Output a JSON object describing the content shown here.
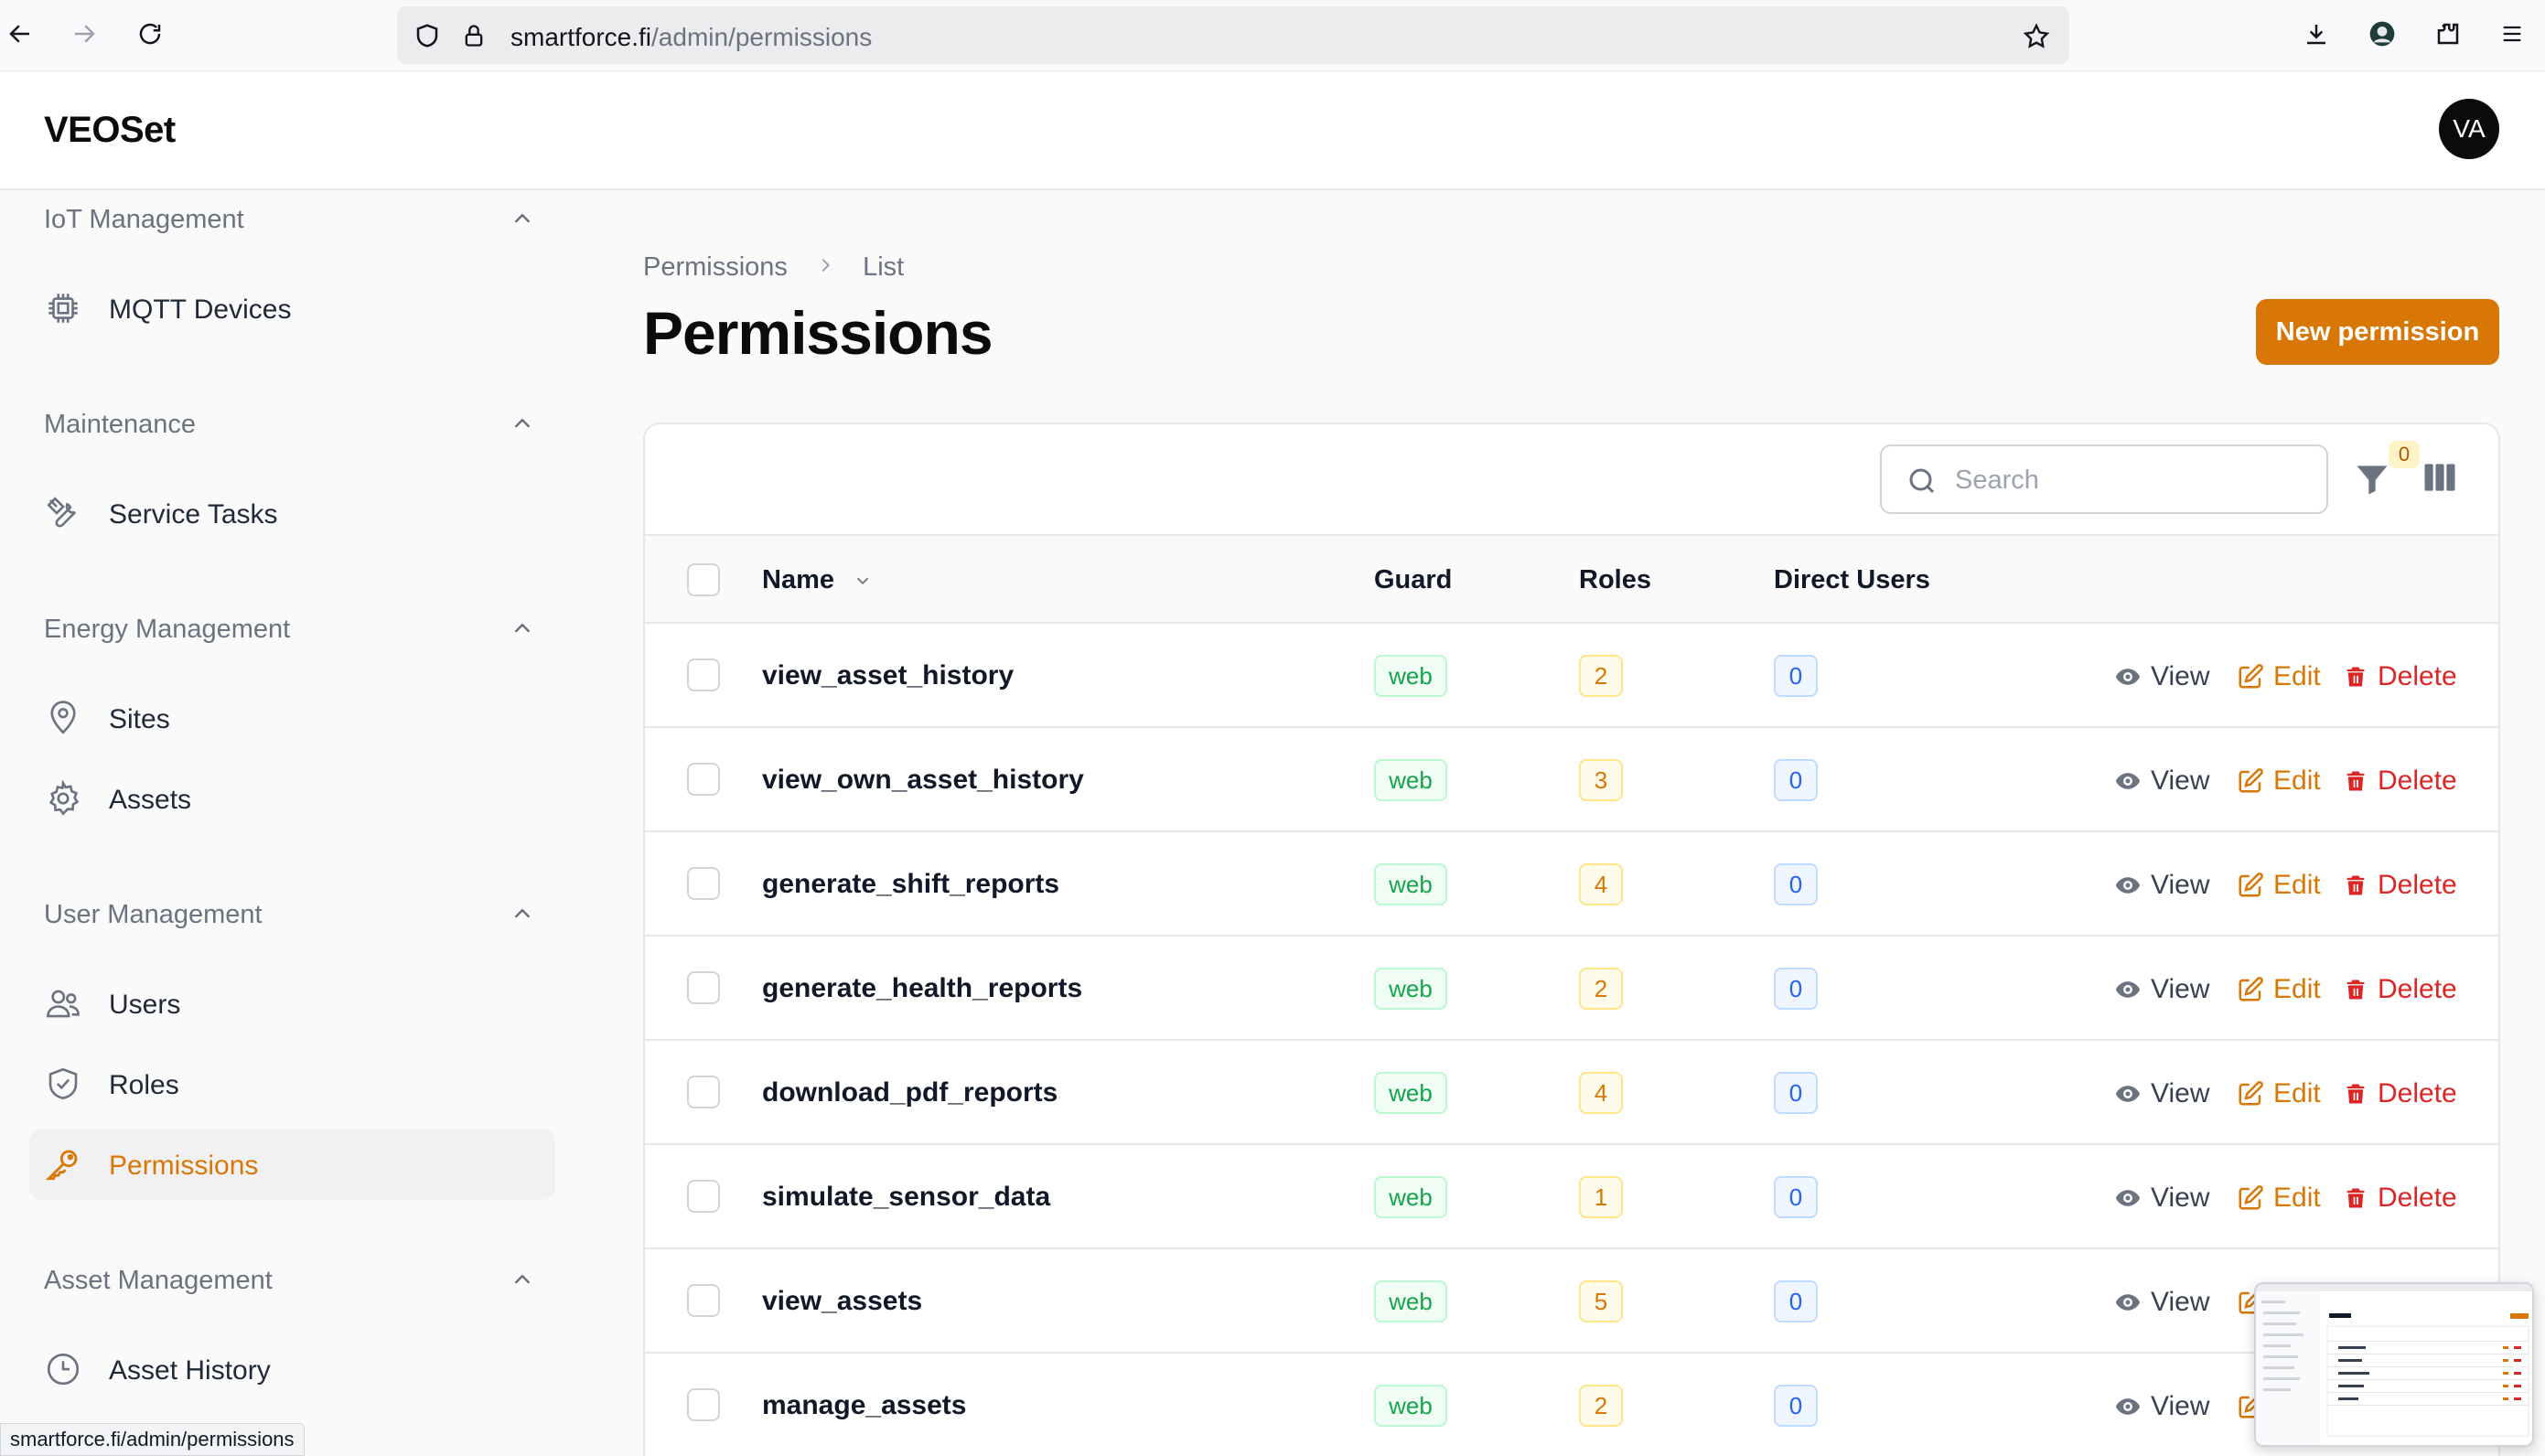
{
  "browser": {
    "url_host": "smartforce.fi",
    "url_path": "/admin/permissions",
    "status_url": "smartforce.fi/admin/permissions"
  },
  "app": {
    "brand": "VEOSet",
    "avatar_initials": "VA"
  },
  "sidebar": {
    "groups": [
      {
        "title": "IoT Management",
        "items": [
          {
            "label": "MQTT Devices",
            "icon": "chip-icon"
          }
        ]
      },
      {
        "title": "Maintenance",
        "items": [
          {
            "label": "Service Tasks",
            "icon": "tools-icon"
          }
        ]
      },
      {
        "title": "Energy Management",
        "items": [
          {
            "label": "Sites",
            "icon": "map-pin-icon"
          },
          {
            "label": "Assets",
            "icon": "gear-icon"
          }
        ]
      },
      {
        "title": "User Management",
        "items": [
          {
            "label": "Users",
            "icon": "users-icon"
          },
          {
            "label": "Roles",
            "icon": "shield-check-icon"
          },
          {
            "label": "Permissions",
            "icon": "key-icon",
            "active": true
          }
        ]
      },
      {
        "title": "Asset Management",
        "items": [
          {
            "label": "Asset History",
            "icon": "clock-icon"
          }
        ]
      }
    ]
  },
  "breadcrumb": {
    "parent": "Permissions",
    "current": "List"
  },
  "page": {
    "title": "Permissions",
    "new_button": "New permission"
  },
  "table": {
    "search_placeholder": "Search",
    "filter_count": "0",
    "columns": {
      "name": "Name",
      "guard": "Guard",
      "roles": "Roles",
      "direct_users": "Direct Users"
    },
    "actions": {
      "view": "View",
      "edit": "Edit",
      "delete": "Delete"
    },
    "rows": [
      {
        "name": "view_asset_history",
        "guard": "web",
        "roles": "2",
        "direct_users": "0"
      },
      {
        "name": "view_own_asset_history",
        "guard": "web",
        "roles": "3",
        "direct_users": "0"
      },
      {
        "name": "generate_shift_reports",
        "guard": "web",
        "roles": "4",
        "direct_users": "0"
      },
      {
        "name": "generate_health_reports",
        "guard": "web",
        "roles": "2",
        "direct_users": "0"
      },
      {
        "name": "download_pdf_reports",
        "guard": "web",
        "roles": "4",
        "direct_users": "0"
      },
      {
        "name": "simulate_sensor_data",
        "guard": "web",
        "roles": "1",
        "direct_users": "0"
      },
      {
        "name": "view_assets",
        "guard": "web",
        "roles": "5",
        "direct_users": "0"
      },
      {
        "name": "manage_assets",
        "guard": "web",
        "roles": "2",
        "direct_users": "0"
      }
    ]
  },
  "colors": {
    "accent": "#d97706",
    "danger": "#dc2626",
    "success": "#16a34a",
    "info": "#2563eb"
  }
}
